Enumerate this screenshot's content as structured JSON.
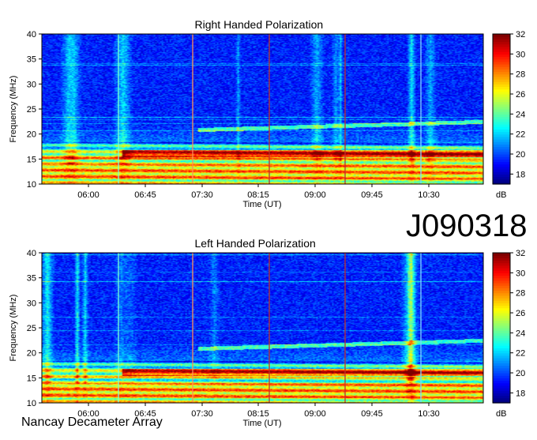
{
  "observation_id": "J090318",
  "instrument": "Nancay Decameter Array",
  "chart_data": [
    {
      "type": "heatmap",
      "title": "Right Handed Polarization",
      "xlabel": "Time (UT)",
      "ylabel": "Frequency (MHz)",
      "xticks": [
        "06:00",
        "06:45",
        "07:30",
        "08:15",
        "09:00",
        "09:45",
        "10:30"
      ],
      "yticks": [
        10,
        15,
        20,
        25,
        30,
        35,
        40
      ],
      "ylim": [
        10,
        40
      ],
      "colorbar": {
        "label": "dB",
        "ticks": [
          18,
          20,
          22,
          24,
          26,
          28,
          30,
          32
        ],
        "range": [
          17,
          32
        ]
      },
      "colormap": [
        "#00007f",
        "#0000ff",
        "#007fff",
        "#00ffff",
        "#7fff7f",
        "#ffff00",
        "#ff7f00",
        "#ff0000",
        "#7f0000"
      ]
    },
    {
      "type": "heatmap",
      "title": "Left Handed Polarization",
      "xlabel": "Time (UT)",
      "ylabel": "Frequency (MHz)",
      "xticks": [
        "06:00",
        "06:45",
        "07:30",
        "08:15",
        "09:00",
        "09:45",
        "10:30"
      ],
      "yticks": [
        10,
        15,
        20,
        25,
        30,
        35,
        40
      ],
      "ylim": [
        10,
        40
      ],
      "colorbar": {
        "label": "dB",
        "ticks": [
          18,
          20,
          22,
          24,
          26,
          28,
          30,
          32
        ],
        "range": [
          17,
          32
        ]
      },
      "colormap": [
        "#00007f",
        "#0000ff",
        "#007fff",
        "#00ffff",
        "#7fff7f",
        "#ffff00",
        "#ff7f00",
        "#ff0000",
        "#7f0000"
      ]
    }
  ]
}
